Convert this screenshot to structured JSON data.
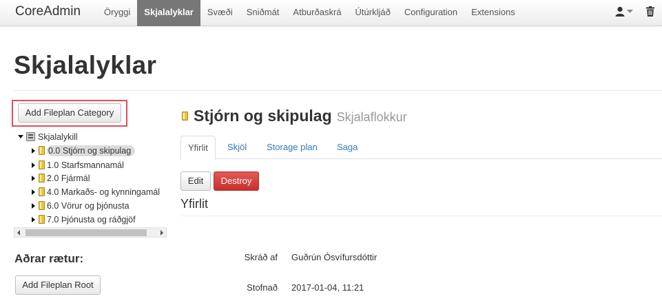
{
  "navbar": {
    "brand": "CoreAdmin",
    "items": [
      {
        "label": "Öryggi",
        "active": false
      },
      {
        "label": "Skjalalyklar",
        "active": true
      },
      {
        "label": "Svæði",
        "active": false
      },
      {
        "label": "Sniðmát",
        "active": false
      },
      {
        "label": "Atburðaskrá",
        "active": false
      },
      {
        "label": "Útúrkljáð",
        "active": false
      },
      {
        "label": "Configuration",
        "active": false
      },
      {
        "label": "Extensions",
        "active": false
      }
    ],
    "icons": {
      "user": "user-icon",
      "caret": "caret-down-icon",
      "trash": "trash-icon"
    }
  },
  "page": {
    "title": "Skjalalyklar"
  },
  "sidebar": {
    "add_category_label": "Add Fileplan Category",
    "tree": {
      "root_label": "Skjalalykill",
      "items": [
        {
          "label": "0.0 Stjórn og skipulag",
          "selected": true
        },
        {
          "label": "1.0 Starfsmannamál",
          "selected": false
        },
        {
          "label": "2.0 Fjármál",
          "selected": false
        },
        {
          "label": "4.0 Markaðs- og kynningamál",
          "selected": false
        },
        {
          "label": "6.0 Vörur og þjónusta",
          "selected": false
        },
        {
          "label": "7.0 Þjónusta og ráðgjöf",
          "selected": false
        }
      ]
    },
    "other_roots_heading": "Aðrar rætur:",
    "add_root_label": "Add Fileplan Root"
  },
  "detail": {
    "title": "Stjórn og skipulag",
    "subtitle": "Skjalaflokkur",
    "tabs": [
      {
        "label": "Yfirlit",
        "active": true
      },
      {
        "label": "Skjöl",
        "active": false
      },
      {
        "label": "Storage plan",
        "active": false
      },
      {
        "label": "Saga",
        "active": false
      }
    ],
    "edit_label": "Edit",
    "destroy_label": "Destroy",
    "section_title": "Yfirlit",
    "fields": [
      {
        "term": "Skráð af",
        "value": "Guðrún Ósvífursdóttir"
      },
      {
        "term": "Stofnað",
        "value": "2017-01-04, 11:21"
      }
    ]
  },
  "colors": {
    "highlight": "#e44b5a",
    "destroy": "#d9534f",
    "link": "#337ab7",
    "active_nav": "#777777"
  }
}
